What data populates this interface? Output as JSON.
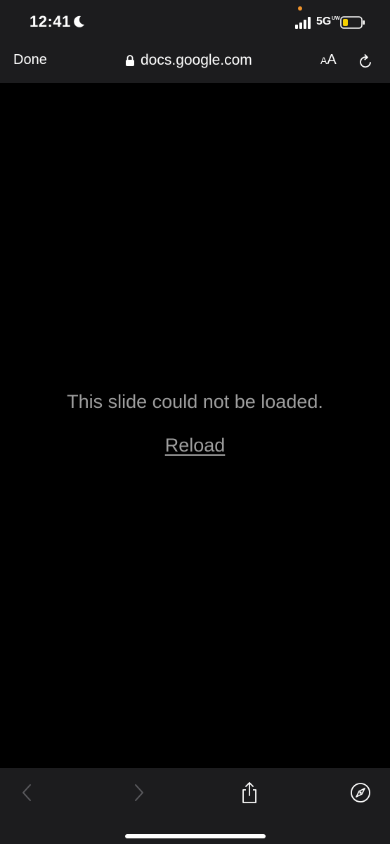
{
  "status_bar": {
    "time": "12:41",
    "network": "5G",
    "network_sub": "UW",
    "icons": [
      "moon-icon",
      "signal-icon",
      "battery-icon"
    ],
    "battery_color": "#f5d000"
  },
  "nav_bar": {
    "done_label": "Done",
    "url": "docs.google.com",
    "text_size_small": "A",
    "text_size_large": "A",
    "icons": [
      "lock-icon",
      "reload-icon"
    ]
  },
  "content": {
    "error_message": "This slide could not be loaded.",
    "reload_label": "Reload"
  },
  "bottom_toolbar": {
    "icons": [
      "back-chevron-icon",
      "forward-chevron-icon",
      "share-icon",
      "compass-icon"
    ]
  },
  "colors": {
    "chrome_bg": "#1c1c1e",
    "content_bg": "#000000",
    "muted_text": "#9e9e9e",
    "disabled_icon": "#5a5a5e"
  }
}
